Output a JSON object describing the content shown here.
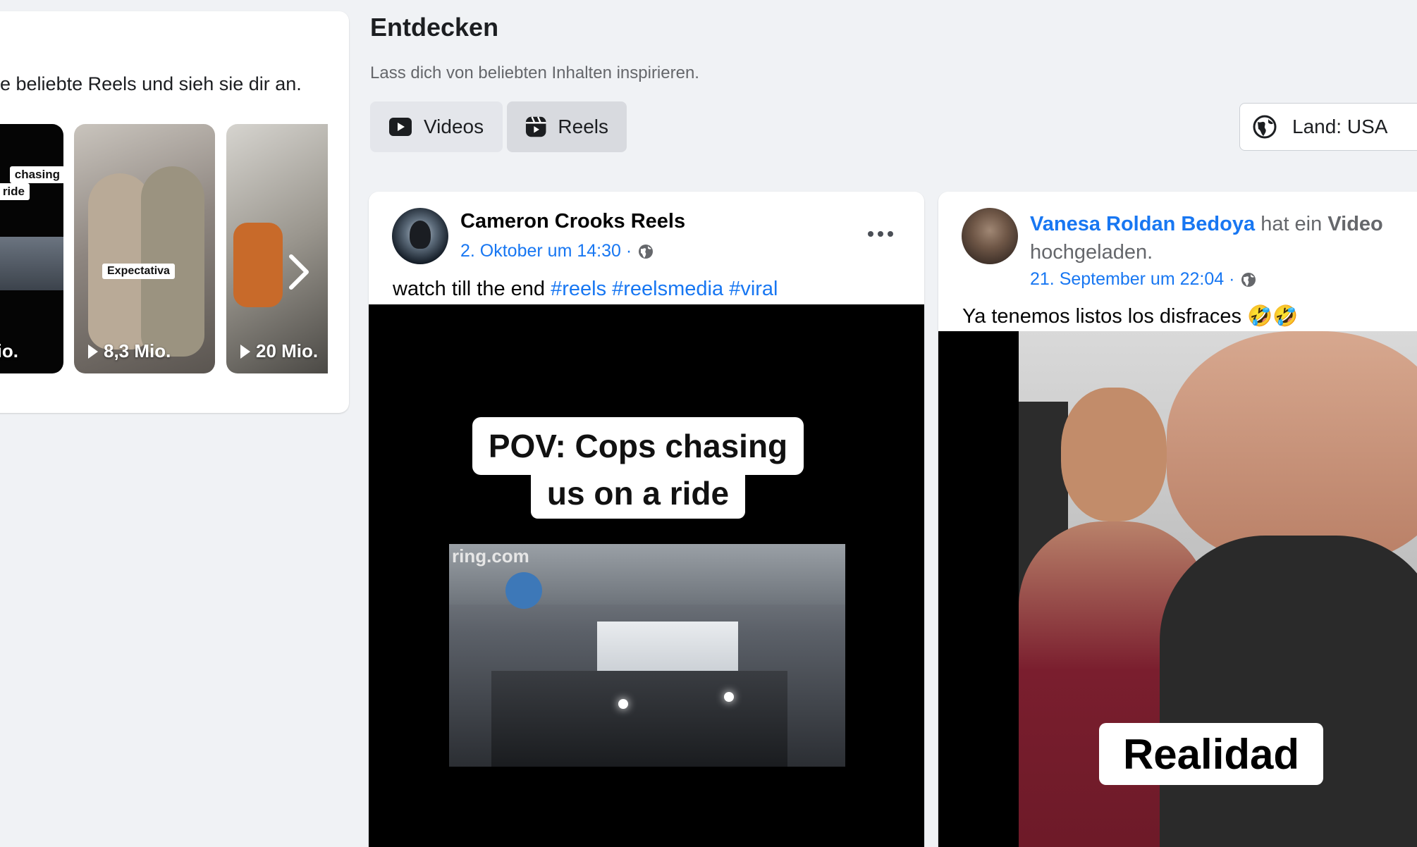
{
  "left_panel": {
    "description": "e beliebte Reels und sieh sie dir an.",
    "thumbnails": [
      {
        "count": "io.",
        "overlay": [
          "chasing",
          "ride"
        ]
      },
      {
        "count": "8,3 Mio.",
        "overlay": [
          "Expectativa"
        ]
      },
      {
        "count": "20 Mio.",
        "overlay": []
      }
    ]
  },
  "header": {
    "title": "Entdecken",
    "subtitle": "Lass dich von beliebten Inhalten inspirieren."
  },
  "tabs": [
    {
      "label": "Videos",
      "icon": "play-icon",
      "active": false
    },
    {
      "label": "Reels",
      "icon": "reels-icon",
      "active": true
    }
  ],
  "country_filter": {
    "label": "Land: USA",
    "icon": "globe-icon"
  },
  "posts": [
    {
      "author": "Cameron Crooks Reels",
      "time": "2. Oktober um 14:30 ·",
      "text": "watch till the end",
      "hashtags": [
        "#reels",
        "#reelsmedia",
        "#viral"
      ],
      "video_caption_line1": "POV: Cops chasing",
      "video_caption_line2": "us on a ride",
      "video_watermark": "ring.com"
    },
    {
      "author": "Vanesa Roldan Bedoya",
      "action_prefix": "hat ein",
      "action_object": "Video",
      "action_suffix": "hochgeladen.",
      "time": "21. September um 22:04 ·",
      "text": "Ya tenemos listos los disfraces 🤣🤣",
      "video_caption": "Realidad"
    }
  ],
  "colors": {
    "link": "#1877f2",
    "background": "#f0f2f5",
    "card": "#ffffff"
  }
}
